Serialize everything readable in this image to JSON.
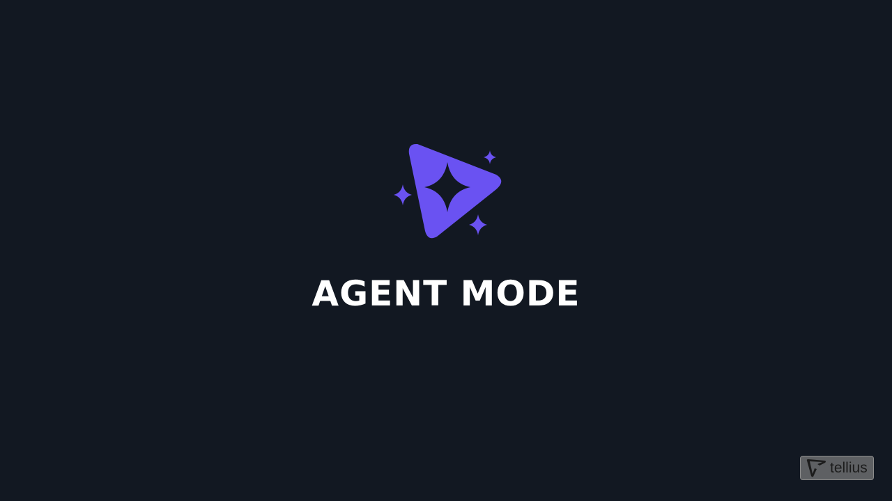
{
  "splash": {
    "title": "AGENT MODE",
    "logo_icon": "play-sparkle-icon",
    "accent_color": "#6a52f2",
    "background_color": "#121822"
  },
  "watermark": {
    "brand_icon": "tellius-logo-icon",
    "brand_text": "tellius"
  }
}
